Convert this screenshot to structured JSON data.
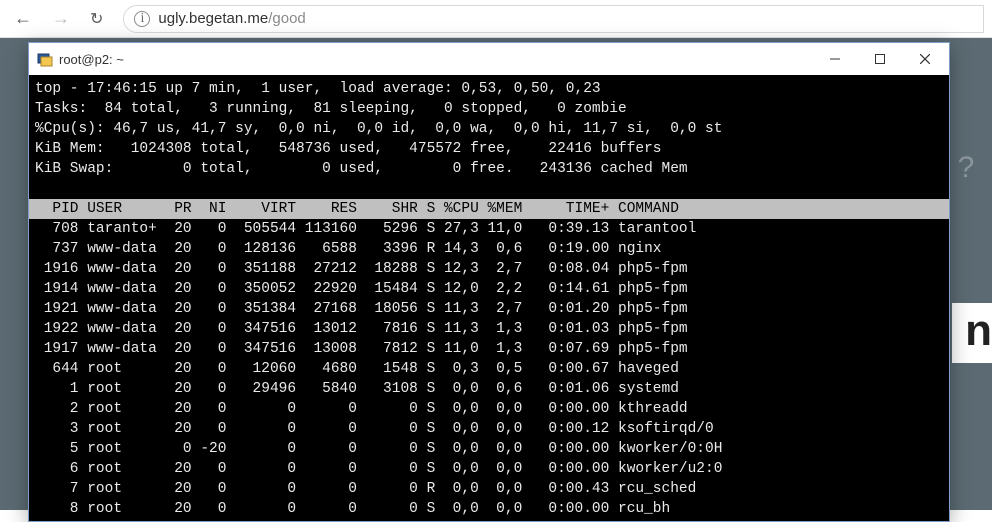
{
  "browser": {
    "url_host": "ugly.begetan.me",
    "url_path": "/good"
  },
  "window": {
    "title": "root@p2: ~"
  },
  "top": {
    "summary_lines": [
      "top - 17:46:15 up 7 min,  1 user,  load average: 0,53, 0,50, 0,23",
      "Tasks:  84 total,   3 running,  81 sleeping,   0 stopped,   0 zombie",
      "%Cpu(s): 46,7 us, 41,7 sy,  0,0 ni,  0,0 id,  0,0 wa,  0,0 hi, 11,7 si,  0,0 st",
      "KiB Mem:   1024308 total,   548736 used,   475572 free,    22416 buffers",
      "KiB Swap:        0 total,        0 used,        0 free.   243136 cached Mem"
    ],
    "header": "  PID USER      PR  NI    VIRT    RES    SHR S %CPU %MEM     TIME+ COMMAND",
    "rows": [
      "  708 taranto+  20   0  505544 113160   5296 S 27,3 11,0   0:39.13 tarantool",
      "  737 www-data  20   0  128136   6588   3396 R 14,3  0,6   0:19.00 nginx",
      " 1916 www-data  20   0  351188  27212  18288 S 12,3  2,7   0:08.04 php5-fpm",
      " 1914 www-data  20   0  350052  22920  15484 S 12,0  2,2   0:14.61 php5-fpm",
      " 1921 www-data  20   0  351384  27168  18056 S 11,3  2,7   0:01.20 php5-fpm",
      " 1922 www-data  20   0  347516  13012   7816 S 11,3  1,3   0:01.03 php5-fpm",
      " 1917 www-data  20   0  347516  13008   7812 S 11,0  1,3   0:07.69 php5-fpm",
      "  644 root      20   0   12060   4680   1548 S  0,3  0,5   0:00.67 haveged",
      "    1 root      20   0   29496   5840   3108 S  0,0  0,6   0:01.06 systemd",
      "    2 root      20   0       0      0      0 S  0,0  0,0   0:00.00 kthreadd",
      "    3 root      20   0       0      0      0 S  0,0  0,0   0:00.12 ksoftirqd/0",
      "    5 root       0 -20       0      0      0 S  0,0  0,0   0:00.00 kworker/0:0H",
      "    6 root      20   0       0      0      0 S  0,0  0,0   0:00.00 kworker/u2:0",
      "    7 root      20   0       0      0      0 R  0,0  0,0   0:00.43 rcu_sched",
      "    8 root      20   0       0      0      0 S  0,0  0,0   0:00.00 rcu_bh"
    ]
  }
}
